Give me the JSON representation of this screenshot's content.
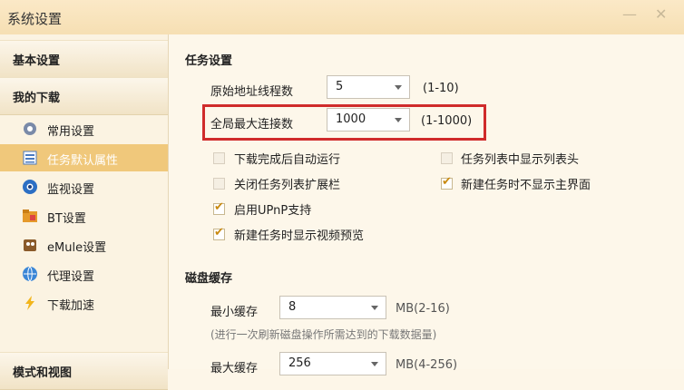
{
  "window": {
    "title": "系统设置",
    "min_icon": "—",
    "close_icon": "✕"
  },
  "sidebar": {
    "group_basic": "基本设置",
    "group_download": "我的下载",
    "items": [
      {
        "label": "常用设置",
        "icon": "gear-icon"
      },
      {
        "label": "任务默认属性",
        "icon": "list-icon",
        "active": true
      },
      {
        "label": "监视设置",
        "icon": "monitor-icon"
      },
      {
        "label": "BT设置",
        "icon": "folder-icon"
      },
      {
        "label": "eMule设置",
        "icon": "emule-icon"
      },
      {
        "label": "代理设置",
        "icon": "globe-icon"
      },
      {
        "label": "下载加速",
        "icon": "lightning-icon"
      }
    ],
    "group_bottom": "模式和视图"
  },
  "task": {
    "title": "任务设置",
    "thread_label": "原始地址线程数",
    "thread_value": "5",
    "thread_range": "(1-10)",
    "conn_label": "全局最大连接数",
    "conn_value": "1000",
    "conn_range": "(1-1000)",
    "checkboxes": [
      {
        "label": "下载完成后自动运行",
        "checked": false
      },
      {
        "label": "任务列表中显示列表头",
        "checked": false
      },
      {
        "label": "关闭任务列表扩展栏",
        "checked": false
      },
      {
        "label": "新建任务时不显示主界面",
        "checked": true
      },
      {
        "label": "启用UPnP支持",
        "checked": true
      },
      {
        "label": "新建任务时显示视频预览",
        "checked": true
      }
    ]
  },
  "disk": {
    "title": "磁盘缓存",
    "min_label": "最小缓存",
    "min_value": "8",
    "min_range": "MB(2-16)",
    "min_note": "(进行一次刷新磁盘操作所需达到的下载数据量)",
    "max_label": "最大缓存",
    "max_value": "256",
    "max_range": "MB(4-256)"
  },
  "colors": {
    "highlight": "#d02b2b",
    "active_item": "#f0c87b",
    "check": "#c98a10"
  }
}
